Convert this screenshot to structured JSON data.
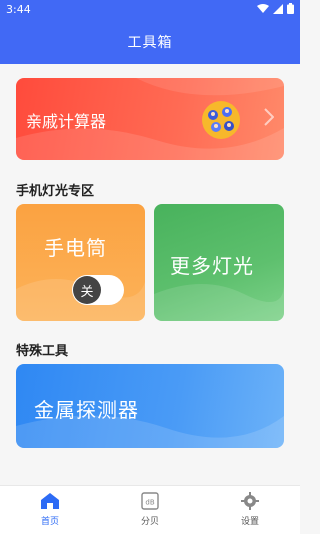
{
  "status_bar": {
    "time": "3:44"
  },
  "app_bar": {
    "title": "工具箱"
  },
  "cards": {
    "relatives": {
      "label": "亲戚计算器"
    },
    "flashlight": {
      "label": "手电筒",
      "toggle_state": "关"
    },
    "more_lights": {
      "label": "更多灯光"
    },
    "metal_detector": {
      "label": "金属探测器"
    }
  },
  "sections": {
    "lights": "手机灯光专区",
    "special_tools": "特殊工具"
  },
  "bottom_nav": [
    {
      "label": "首页",
      "icon": "home-icon",
      "active": true
    },
    {
      "label": "分贝",
      "icon": "decibel-icon",
      "active": false
    },
    {
      "label": "设置",
      "icon": "gear-icon",
      "active": false
    }
  ],
  "colors": {
    "primary": "#4169f5",
    "relatives_card": "#ff5b48",
    "flashlight_card": "#fca34a",
    "more_lights_card": "#55b866",
    "metal_card": "#3a90f4",
    "nav_active": "#2d6bf5"
  }
}
